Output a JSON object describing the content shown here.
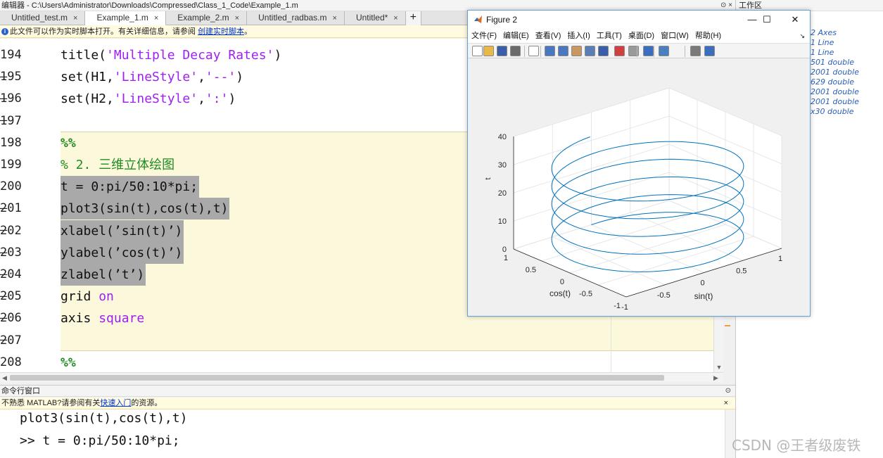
{
  "editor": {
    "title": "编辑器 - C:\\Users\\Administrator\\Downloads\\Compressed\\Class_1_Code\\Example_1.m",
    "tabs": [
      {
        "label": "Untitled_test.m",
        "close": "×"
      },
      {
        "label": "Example_1.m",
        "close": "×"
      },
      {
        "label": "Example_2.m",
        "close": "×"
      },
      {
        "label": "Untitled_radbas.m",
        "close": "×"
      },
      {
        "label": "Untitled*",
        "close": "×"
      }
    ],
    "add_tab": "+",
    "info_text": "此文件可以作为实时脚本打开。有关详细信息，请参阅",
    "info_link": "创建实时脚本",
    "info_end": "。",
    "lines": [
      {
        "n": "194 —",
        "parts": [
          [
            "title(",
            ""
          ],
          [
            "'Multiple Decay Rates'",
            "str"
          ],
          [
            ")",
            ""
          ]
        ]
      },
      {
        "n": "195 —",
        "parts": [
          [
            "set(H1,",
            ""
          ],
          [
            "'LineStyle'",
            "str"
          ],
          [
            ",",
            ""
          ],
          [
            "'--'",
            "str"
          ],
          [
            ")",
            ""
          ]
        ]
      },
      {
        "n": "196 —",
        "parts": [
          [
            "set(H2,",
            ""
          ],
          [
            "'LineStyle'",
            "str"
          ],
          [
            ",",
            ""
          ],
          [
            "':'",
            "str"
          ],
          [
            ")",
            ""
          ]
        ]
      },
      {
        "n": "197",
        "parts": []
      },
      {
        "n": "198",
        "parts": [
          [
            "%%",
            "cell"
          ]
        ]
      },
      {
        "n": "199",
        "parts": [
          [
            "% 2. 三维立体绘图",
            "cmt"
          ]
        ]
      },
      {
        "n": "200 —",
        "sel": true,
        "parts": [
          [
            "t = 0:pi/50:10*pi;",
            ""
          ]
        ]
      },
      {
        "n": "201 —",
        "sel": true,
        "parts": [
          [
            "plot3(sin(t),cos(t),t)",
            ""
          ]
        ]
      },
      {
        "n": "202 —",
        "sel": true,
        "parts": [
          [
            "xlabel(’sin(t)’)",
            ""
          ]
        ]
      },
      {
        "n": "203 —",
        "sel": true,
        "parts": [
          [
            "ylabel(’cos(t)’)",
            ""
          ]
        ]
      },
      {
        "n": "204 —",
        "sel": true,
        "parts": [
          [
            "zlabel(’t’)",
            ""
          ]
        ]
      },
      {
        "n": "205 —",
        "parts": [
          [
            "grid ",
            ""
          ],
          [
            "on",
            "kw"
          ]
        ]
      },
      {
        "n": "206 —",
        "parts": [
          [
            "axis ",
            ""
          ],
          [
            "square",
            "kw"
          ]
        ]
      },
      {
        "n": "207",
        "parts": []
      },
      {
        "n": "208 —",
        "parts": [
          [
            "%%",
            "cell"
          ]
        ]
      }
    ]
  },
  "command_window": {
    "title": "命令行窗口",
    "info_text": "不熟悉 MATLAB?请参阅有关",
    "info_link": "快速入门",
    "info_end": "的资源。",
    "close": "×",
    "lines": [
      "plot3(sin(t),cos(t),t)",
      ">> t = 0:pi/50:10*pi;"
    ]
  },
  "workspace": {
    "title": "工作区",
    "items": [
      "2 Axes",
      "1 Line",
      "1 Line",
      "501 double",
      "2001 double",
      "629 double",
      "2001 double",
      "2001 double",
      "x30 double"
    ]
  },
  "figure": {
    "title": "Figure 2",
    "controls": {
      "minimize": "—",
      "maximize": "☐",
      "close": "✕"
    },
    "menu": [
      "文件(F)",
      "编辑(E)",
      "查看(V)",
      "插入(I)",
      "工具(T)",
      "桌面(D)",
      "窗口(W)",
      "帮助(H)"
    ],
    "toolbar_icons": [
      "new-file-icon",
      "open-folder-icon",
      "save-icon",
      "print-icon",
      "pointer-icon",
      "zoom-in-icon",
      "zoom-out-icon",
      "pan-hand-icon",
      "rotate-3d-icon",
      "data-cursor-icon",
      "brush-icon",
      "link-icon",
      "colorbar-icon",
      "legend-icon",
      "hide-plot-tools-icon",
      "show-plot-tools-icon"
    ]
  },
  "chart_data": {
    "type": "line",
    "plot_kind": "3d-helix",
    "x_expr": "sin(t)",
    "y_expr": "cos(t)",
    "z_expr": "t",
    "t_range": [
      0,
      31.4159
    ],
    "t_step": 0.0628,
    "xlabel": "sin(t)",
    "ylabel": "cos(t)",
    "zlabel": "t",
    "xlim": [
      -1,
      1
    ],
    "ylim": [
      -1,
      1
    ],
    "zlim": [
      0,
      40
    ],
    "x_ticks": [
      "-1",
      "-0.5",
      "0",
      "0.5",
      "1"
    ],
    "y_ticks": [
      "-1",
      "-0.5",
      "0",
      "0.5",
      "1"
    ],
    "z_ticks": [
      "0",
      "10",
      "20",
      "30",
      "40"
    ],
    "grid": true,
    "line_color": "#0072bd"
  },
  "watermark": "CSDN @王者级废铁",
  "colors": {
    "cell_bg": "#fbf8dc",
    "string": "#a020f0",
    "comment": "#228b22",
    "selection": "#a9a9a9"
  }
}
